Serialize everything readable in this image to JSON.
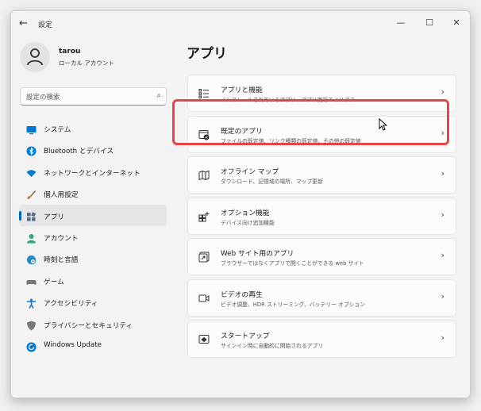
{
  "window": {
    "title": "設定"
  },
  "controls": {
    "back": "←",
    "minimize": "—",
    "maximize": "☐",
    "close": "✕"
  },
  "profile": {
    "name": "tarou",
    "account_type": "ローカル アカウント"
  },
  "search": {
    "placeholder": "設定の検索"
  },
  "nav": [
    {
      "label": "システム",
      "icon": "monitor-icon",
      "color": "#0078d4"
    },
    {
      "label": "Bluetooth とデバイス",
      "icon": "bluetooth-icon",
      "color": "#0078d4"
    },
    {
      "label": "ネットワークとインターネット",
      "icon": "wifi-icon",
      "color": "#0078d4"
    },
    {
      "label": "個人用設定",
      "icon": "brush-icon",
      "color": "#c07a3a"
    },
    {
      "label": "アプリ",
      "icon": "apps-icon",
      "color": "#5a6a80",
      "selected": true
    },
    {
      "label": "アカウント",
      "icon": "person-icon",
      "color": "#2aa876"
    },
    {
      "label": "時刻と言語",
      "icon": "globe-clock-icon",
      "color": "#1e88c8"
    },
    {
      "label": "ゲーム",
      "icon": "gamepad-icon",
      "color": "#777777"
    },
    {
      "label": "アクセシビリティ",
      "icon": "accessibility-icon",
      "color": "#1a73c8"
    },
    {
      "label": "プライバシーとセキュリティ",
      "icon": "shield-icon",
      "color": "#777777"
    },
    {
      "label": "Windows Update",
      "icon": "update-icon",
      "color": "#0078d4"
    }
  ],
  "main": {
    "title": "アプリ",
    "cards": [
      {
        "title": "アプリと機能",
        "desc": "インストールされているアプリ、アプリ実行エイリアス",
        "icon": "list-icon"
      },
      {
        "title": "既定のアプリ",
        "desc": "ファイルの既定値、リンク種類の既定値、その他の既定値",
        "icon": "default-apps-icon",
        "highlighted": true
      },
      {
        "title": "オフライン マップ",
        "desc": "ダウンロード、記憶域の場所、マップ更新",
        "icon": "map-icon"
      },
      {
        "title": "オプション機能",
        "desc": "デバイス向け追加機能",
        "icon": "grid-plus-icon"
      },
      {
        "title": "Web サイト用のアプリ",
        "desc": "ブラウザーではなくアプリで開くことができる web サイト",
        "icon": "web-app-icon"
      },
      {
        "title": "ビデオの再生",
        "desc": "ビデオ調整、HDR ストリーミング、バッテリー オプション",
        "icon": "video-icon"
      },
      {
        "title": "スタートアップ",
        "desc": "サインイン時に自動的に開始されるアプリ",
        "icon": "startup-icon"
      }
    ]
  },
  "colors": {
    "accent": "#0067c0",
    "highlight": "#e64545"
  }
}
